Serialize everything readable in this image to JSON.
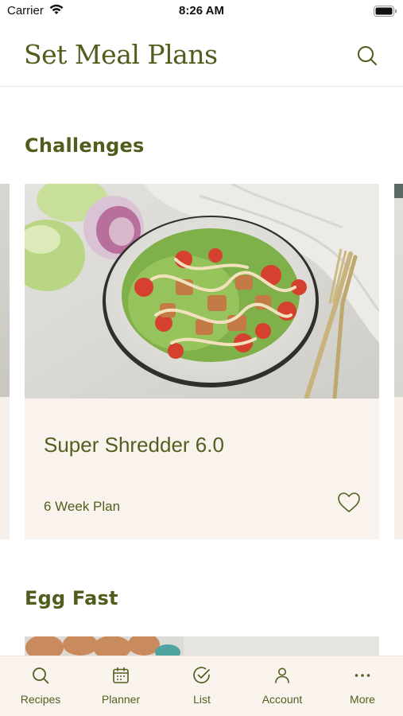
{
  "status_bar": {
    "carrier": "Carrier",
    "time": "8:26 AM"
  },
  "header": {
    "title": "Set Meal Plans",
    "search_icon": "search-icon"
  },
  "sections": [
    {
      "title": "Challenges",
      "cards": [
        {
          "title": "Super Shredder 6.0",
          "subtitle": "6 Week Plan",
          "favorite_icon": "heart-icon"
        }
      ]
    },
    {
      "title": "Egg Fast"
    }
  ],
  "tab_bar": {
    "items": [
      {
        "label": "Recipes",
        "icon": "search-icon"
      },
      {
        "label": "Planner",
        "icon": "calendar-icon"
      },
      {
        "label": "List",
        "icon": "check-circle-icon"
      },
      {
        "label": "Account",
        "icon": "person-icon"
      },
      {
        "label": "More",
        "icon": "more-dots-icon"
      }
    ]
  },
  "colors": {
    "brand_green": "#4f5d1d",
    "card_bg": "#f9f2ed",
    "tab_bg": "#faf3ee"
  }
}
